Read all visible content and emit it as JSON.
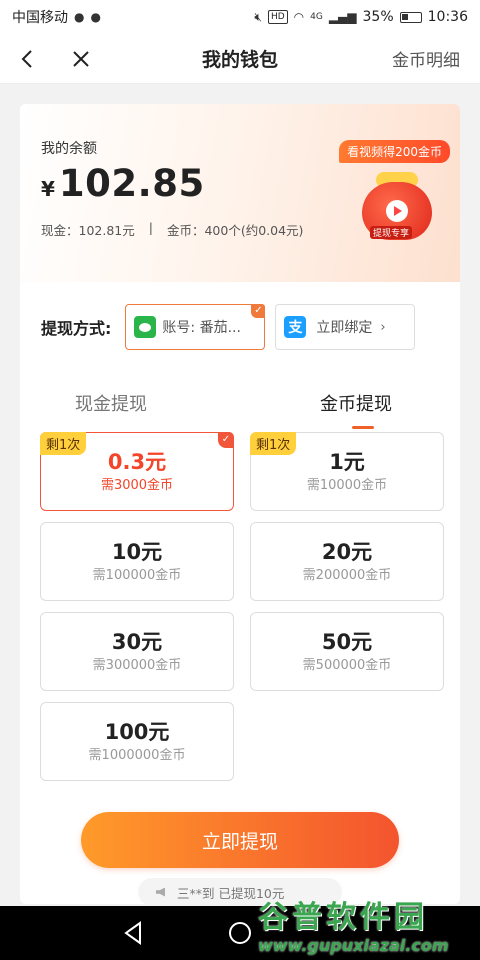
{
  "status_bar": {
    "carrier": "中国移动",
    "battery": "35%",
    "time": "10:36",
    "network": "4G",
    "hd": "HD"
  },
  "nav": {
    "title": "我的钱包",
    "right_link": "金币明细"
  },
  "balance": {
    "label": "我的余额",
    "currency": "¥",
    "amount": "102.85",
    "cash": "现金：102.81元",
    "separator": "|",
    "coins": "金币：400个(约0.04元)",
    "promo": "看视频得200金币",
    "bag_label": "提现专享"
  },
  "method": {
    "label": "提现方式:",
    "wechat_text": "账号: 番茄...",
    "alipay_text": "立即绑定",
    "alipay_glyph": "支"
  },
  "tabs": {
    "cash": "现金提现",
    "coin": "金币提现"
  },
  "options": [
    {
      "amount": "0.3元",
      "need": "需3000金币",
      "tag": "剩1次",
      "selected": true
    },
    {
      "amount": "1元",
      "need": "需10000金币",
      "tag": "剩1次",
      "selected": false
    },
    {
      "amount": "10元",
      "need": "需100000金币",
      "tag": "",
      "selected": false
    },
    {
      "amount": "20元",
      "need": "需200000金币",
      "tag": "",
      "selected": false
    },
    {
      "amount": "30元",
      "need": "需300000金币",
      "tag": "",
      "selected": false
    },
    {
      "amount": "50元",
      "need": "需500000金币",
      "tag": "",
      "selected": false
    },
    {
      "amount": "100元",
      "need": "需1000000金币",
      "tag": "",
      "selected": false
    }
  ],
  "cta": "立即提现",
  "ticker": "三**到 已提现10元",
  "watermark": {
    "top": "谷普软件园",
    "bottom": "www.gupuxiazai.com"
  },
  "colors": {
    "accent": "#f2563a",
    "cta_start": "#ff9a2a",
    "cta_end": "#f4542e",
    "tag": "#ffcf3c",
    "wechat": "#2ab54a",
    "alipay": "#1a9fff"
  }
}
